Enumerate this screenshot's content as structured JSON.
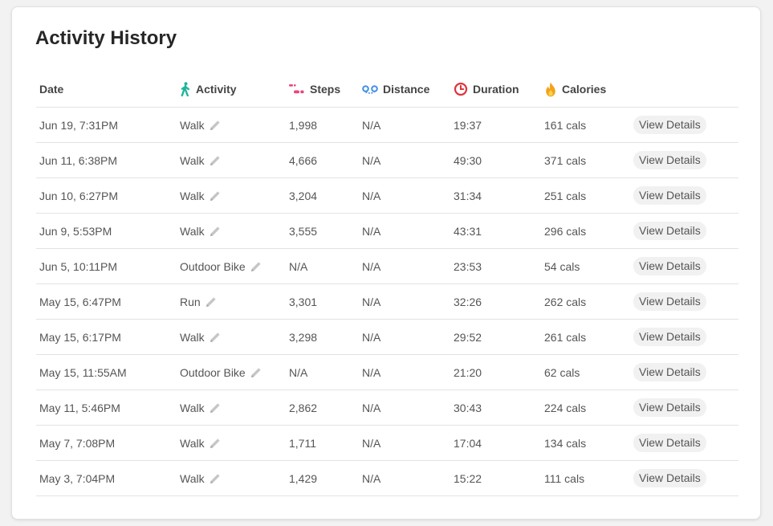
{
  "title": "Activity History",
  "columns": {
    "date": "Date",
    "activity": "Activity",
    "steps": "Steps",
    "distance": "Distance",
    "duration": "Duration",
    "calories": "Calories"
  },
  "icons": {
    "activity": "walking-person-icon",
    "steps": "footprints-icon",
    "distance": "route-icon",
    "duration": "clock-icon",
    "calories": "flame-icon",
    "edit": "pencil-icon"
  },
  "colors": {
    "activity_icon": "#1fb59a",
    "steps_icon": "#e8457a",
    "distance_icon": "#3f8fe6",
    "duration_icon": "#e0333b",
    "calories_icon": "#f3a21c"
  },
  "rows": [
    {
      "date": "Jun 19, 7:31PM",
      "activity": "Walk",
      "steps": "1,998",
      "distance": "N/A",
      "duration": "19:37",
      "calories": "161 cals",
      "action": "View Details"
    },
    {
      "date": "Jun 11, 6:38PM",
      "activity": "Walk",
      "steps": "4,666",
      "distance": "N/A",
      "duration": "49:30",
      "calories": "371 cals",
      "action": "View Details"
    },
    {
      "date": "Jun 10, 6:27PM",
      "activity": "Walk",
      "steps": "3,204",
      "distance": "N/A",
      "duration": "31:34",
      "calories": "251 cals",
      "action": "View Details"
    },
    {
      "date": "Jun 9, 5:53PM",
      "activity": "Walk",
      "steps": "3,555",
      "distance": "N/A",
      "duration": "43:31",
      "calories": "296 cals",
      "action": "View Details"
    },
    {
      "date": "Jun 5, 10:11PM",
      "activity": "Outdoor Bike",
      "steps": "N/A",
      "distance": "N/A",
      "duration": "23:53",
      "calories": "54 cals",
      "action": "View Details"
    },
    {
      "date": "May 15, 6:47PM",
      "activity": "Run",
      "steps": "3,301",
      "distance": "N/A",
      "duration": "32:26",
      "calories": "262 cals",
      "action": "View Details"
    },
    {
      "date": "May 15, 6:17PM",
      "activity": "Walk",
      "steps": "3,298",
      "distance": "N/A",
      "duration": "29:52",
      "calories": "261 cals",
      "action": "View Details"
    },
    {
      "date": "May 15, 11:55AM",
      "activity": "Outdoor Bike",
      "steps": "N/A",
      "distance": "N/A",
      "duration": "21:20",
      "calories": "62 cals",
      "action": "View Details"
    },
    {
      "date": "May 11, 5:46PM",
      "activity": "Walk",
      "steps": "2,862",
      "distance": "N/A",
      "duration": "30:43",
      "calories": "224 cals",
      "action": "View Details"
    },
    {
      "date": "May 7, 7:08PM",
      "activity": "Walk",
      "steps": "1,711",
      "distance": "N/A",
      "duration": "17:04",
      "calories": "134 cals",
      "action": "View Details"
    },
    {
      "date": "May 3, 7:04PM",
      "activity": "Walk",
      "steps": "1,429",
      "distance": "N/A",
      "duration": "15:22",
      "calories": "111 cals",
      "action": "View Details"
    }
  ]
}
